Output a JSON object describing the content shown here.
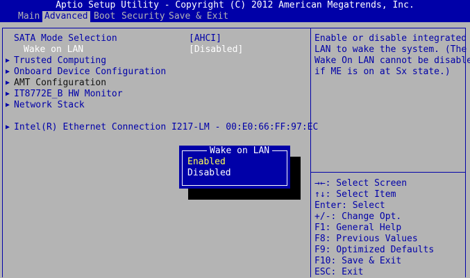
{
  "header": {
    "title": "Aptio Setup Utility - Copyright (C) 2012 American Megatrends, Inc."
  },
  "menu": {
    "tabs": [
      {
        "label": "Main"
      },
      {
        "label": "Advanced"
      },
      {
        "label": "Boot"
      },
      {
        "label": "Security"
      },
      {
        "label": "Save & Exit"
      }
    ],
    "active": "Advanced"
  },
  "settings": {
    "items": [
      {
        "label": "SATA Mode Selection",
        "value": "[AHCI]"
      },
      {
        "label": "Wake on LAN",
        "value": "[Disabled]"
      },
      {
        "label": "Trusted Computing"
      },
      {
        "label": "Onboard Device Configuration"
      },
      {
        "label": "AMT Configuration"
      },
      {
        "label": "IT8772E_B HW Monitor"
      },
      {
        "label": "Network Stack"
      },
      {
        "label": "Intel(R) Ethernet Connection I217-LM - 00:E0:66:FF:97:EC"
      }
    ]
  },
  "help": {
    "lines": [
      "Enable or disable integrated",
      "LAN to wake the system. (The",
      "Wake On LAN cannot be disabled",
      "if ME is on at Sx state.)"
    ]
  },
  "keys": {
    "lines": [
      "→←: Select Screen",
      "↑↓: Select Item",
      "Enter: Select",
      "+/-: Change Opt.",
      "F1: General Help",
      "F8: Previous Values",
      "F9: Optimized Defaults",
      "F10: Save & Exit",
      "ESC: Exit"
    ]
  },
  "popup": {
    "title": "Wake on LAN",
    "options": [
      "Enabled",
      "Disabled"
    ],
    "selected": "Enabled"
  },
  "colors": {
    "bios_blue": "#0000a8",
    "bios_gray": "#b4b4b4",
    "highlight_yellow": "#ffff55"
  },
  "icons": {
    "submenu_arrow": "submenu-arrow-icon"
  }
}
